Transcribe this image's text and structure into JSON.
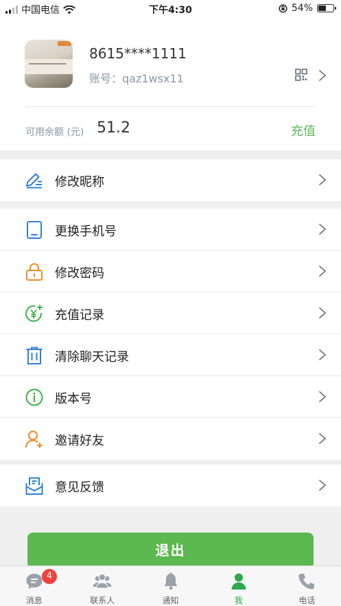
{
  "status_bar": {
    "carrier": "中国电信",
    "time": "下午4:30",
    "battery_percent": "54%",
    "battery_level": 0.54
  },
  "profile": {
    "phone": "8615****1111",
    "account": "账号：qaz1wsx11",
    "balance_label": "可用余额 (元)",
    "balance_value": "51.2",
    "recharge_label": "充值"
  },
  "menu": {
    "nickname": "修改昵称",
    "change_phone": "更换手机号",
    "change_password": "修改密码",
    "recharge_records": "充值记录",
    "clear_chat": "清除聊天记录",
    "version": "版本号",
    "invite": "邀请好友",
    "feedback": "意见反馈"
  },
  "logout_label": "退出",
  "tabs": {
    "messages": "消息",
    "contacts": "联系人",
    "notifications": "通知",
    "me": "我",
    "phone": "电话",
    "messages_badge": "4"
  },
  "colors": {
    "accent_green": "#5cb850",
    "blue_icon": "#2f7fd8",
    "orange_icon": "#f08a24",
    "badge_red": "#f2413b"
  }
}
